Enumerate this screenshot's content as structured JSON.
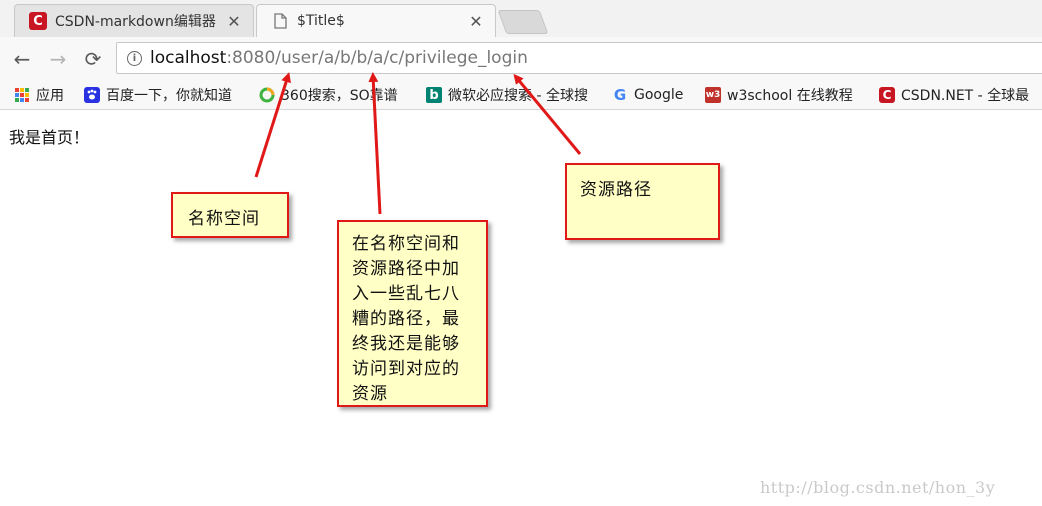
{
  "tabs": [
    {
      "title": "CSDN-markdown编辑器",
      "favicon": "csdn-icon",
      "active": false
    },
    {
      "title": "$Title$",
      "favicon": "page-icon",
      "active": true
    }
  ],
  "toolbar": {
    "back": "←",
    "forward": "→",
    "reload": "⟳",
    "url_host": "localhost",
    "url_rest": ":8080/user/a/b/b/a/c/privilege_login"
  },
  "bookmarks": [
    {
      "label": "应用",
      "icon": "apps-grid-icon"
    },
    {
      "label": "百度一下，你就知道",
      "icon": "baidu-paw-icon"
    },
    {
      "label": "360搜索，SO靠谱",
      "icon": "so360-icon"
    },
    {
      "label": "微软必应搜索 - 全球搜",
      "icon": "bing-icon"
    },
    {
      "label": "Google",
      "icon": "google-icon"
    },
    {
      "label": "w3school 在线教程",
      "icon": "w3school-icon"
    },
    {
      "label": "CSDN.NET - 全球最",
      "icon": "csdn-icon"
    }
  ],
  "page": {
    "body_text": "我是首页！"
  },
  "annotations": {
    "namespace": "名称空间",
    "resource_path": "资源路径",
    "middle_lines": [
      "在名称空间和",
      "资源路径中加",
      "入一些乱七八",
      "糟的路径，最",
      "终我还是能够",
      "访问到对应的",
      "资源"
    ]
  },
  "watermark": "http://blog.csdn.net/hon_3y",
  "colors": {
    "note_fill": "#ffffc6",
    "note_border": "#e01818",
    "arrow": "#e01818"
  }
}
